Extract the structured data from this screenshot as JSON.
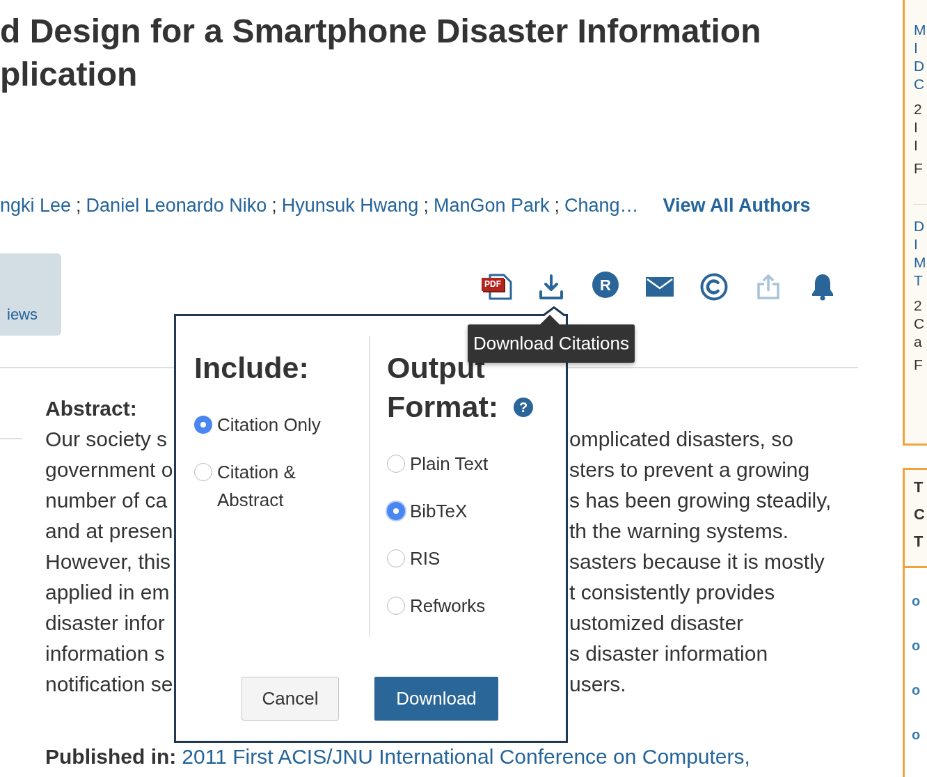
{
  "title": {
    "lines": [
      "d Design for a Smartphone Disaster Information",
      "plication"
    ]
  },
  "authors": [
    {
      "name": "ngki Lee",
      "separator": ";"
    },
    {
      "name": "Daniel Leonardo Niko",
      "separator": ";"
    },
    {
      "name": "Hyunsuk Hwang",
      "separator": ";"
    },
    {
      "name": "ManGon Park",
      "separator": ";"
    },
    {
      "name": "Chang…"
    }
  ],
  "view_all_authors": "View All Authors",
  "metrics": {
    "label": "iews"
  },
  "toolbar": [
    {
      "kind": "pdf",
      "label": "PDF",
      "disabled": false
    },
    {
      "kind": "download",
      "disabled": false
    },
    {
      "kind": "rights",
      "glyph": "R",
      "disabled": false
    },
    {
      "kind": "email",
      "disabled": false
    },
    {
      "kind": "copyright",
      "disabled": false
    },
    {
      "kind": "share",
      "disabled": true
    },
    {
      "kind": "alert",
      "disabled": false
    }
  ],
  "tooltip": {
    "text": "Download Citations"
  },
  "abstract": {
    "heading": "Abstract:",
    "lines": [
      {
        "left": "Our society s",
        "right": "omplicated disasters, so"
      },
      {
        "left": "government o",
        "right": "sters to prevent a growing"
      },
      {
        "left": "number of ca",
        "right": "s has been growing steadily,"
      },
      {
        "left": "and at presen",
        "right": "th the warning systems."
      },
      {
        "left": "However, this",
        "right": "sasters because it is mostly"
      },
      {
        "left": "applied in em",
        "right": "t consistently provides"
      },
      {
        "left": "disaster infor",
        "right": "ustomized disaster"
      },
      {
        "left": "information s",
        "right": "s disaster information"
      },
      {
        "left": "notification se",
        "right": "users."
      }
    ]
  },
  "published_in": {
    "label": "Published in:",
    "link": "2011 First ACIS/JNU International Conference on Computers,"
  },
  "citation_dialog": {
    "include": {
      "heading": "Include:",
      "options": [
        {
          "label": "Citation Only",
          "selected": true
        },
        {
          "label": "Citation & Abstract",
          "selected": false
        }
      ]
    },
    "output_format": {
      "heading": "Output Format:",
      "help_glyph": "?",
      "options": [
        {
          "label": "Plain Text",
          "selected": false,
          "focused": false
        },
        {
          "label": "BibTeX",
          "selected": true,
          "focused": true
        },
        {
          "label": "RIS",
          "selected": false,
          "focused": false
        },
        {
          "label": "Refworks",
          "selected": false,
          "focused": false
        }
      ]
    },
    "buttons": [
      {
        "label": "Cancel",
        "kind": "secondary"
      },
      {
        "label": "Download",
        "kind": "primary"
      }
    ]
  },
  "sidebar": {
    "related": [
      {
        "title_lines": [
          "M",
          "I",
          "D",
          "C"
        ],
        "meta_lines": [
          "2",
          "I",
          "I"
        ],
        "footer": "F"
      },
      {
        "title_lines": [
          "D",
          "I",
          "M",
          "T"
        ],
        "meta_lines": [
          "2",
          "C",
          "a"
        ],
        "footer": "F"
      }
    ],
    "panel": {
      "heading_lines": [
        "T",
        "C",
        "T"
      ],
      "items": [
        "o",
        "o",
        "o",
        "o"
      ]
    }
  }
}
